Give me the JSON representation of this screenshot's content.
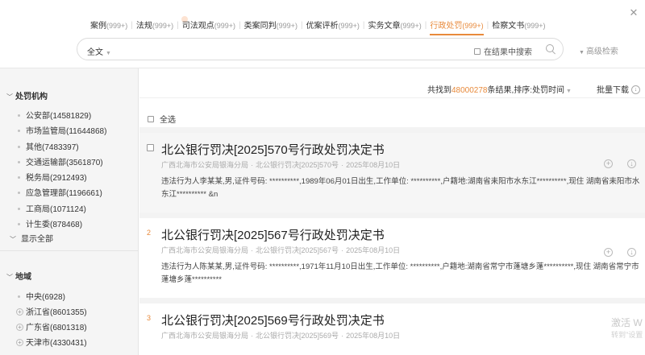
{
  "tabs": [
    {
      "label": "案例",
      "count": "(999+)"
    },
    {
      "label": "法规",
      "count": "(999+)"
    },
    {
      "label": "司法观点",
      "count": "(999+)"
    },
    {
      "label": "类案同判",
      "count": "(999+)"
    },
    {
      "label": "优案评析",
      "count": "(999+)"
    },
    {
      "label": "实务文章",
      "count": "(999+)"
    },
    {
      "label": "行政处罚",
      "count": "(999+)"
    },
    {
      "label": "检察文书",
      "count": "(999+)"
    }
  ],
  "search": {
    "scope": "全文",
    "value": "",
    "within_label": "在结果中搜索",
    "advanced_label": "高级检索"
  },
  "sidebar": {
    "penalty_org_title": "处罚机构",
    "penalty_orgs": [
      "公安部(14581829)",
      "市场监管局(11644868)",
      "其他(7483397)",
      "交通运输部(3561870)",
      "税务局(2912493)",
      "应急管理部(1196661)",
      "工商局(1071124)",
      "计生委(878468)"
    ],
    "show_all": "显示全部",
    "region_title": "地域",
    "regions": [
      {
        "label": "中央(6928)",
        "expandable": false
      },
      {
        "label": "浙江省(8601355)",
        "expandable": true
      },
      {
        "label": "广东省(6801318)",
        "expandable": true
      },
      {
        "label": "天津市(4330431)",
        "expandable": true
      }
    ]
  },
  "results": {
    "prefix": "共找到",
    "count": "48000278",
    "suffix": "条结果,排序:",
    "sort": "处罚时间",
    "batch_download": "批量下载",
    "select_all": "全选"
  },
  "items": [
    {
      "index": "",
      "title": "北公银行罚决[2025]570号行政处罚决定书",
      "authority": "广西北海市公安局银海分局",
      "docno": "北公银行罚决[2025]570号",
      "date": "2025年08月10日",
      "snippet": "违法行为人李某某,男,证件号码: **********,1989年06月01日出生,工作单位: **********,户籍地:湖南省耒阳市水东江**********,现住 湖南省耒阳市水东江********** &n"
    },
    {
      "index": "2",
      "title": "北公银行罚决[2025]567号行政处罚决定书",
      "authority": "广西北海市公安局银海分局",
      "docno": "北公银行罚决[2025]567号",
      "date": "2025年08月10日",
      "snippet": "违法行为人陈某某,男,证件号码: **********,1971年11月10日出生,工作单位: **********,户籍地:湖南省常宁市蓬塘乡蓬**********,现住 湖南省常宁市蓬塘乡蓬**********"
    },
    {
      "index": "3",
      "title": "北公银行罚决[2025]569号行政处罚决定书",
      "authority": "广西北海市公安局银海分局",
      "docno": "北公银行罚决[2025]569号",
      "date": "2025年08月10日",
      "snippet": ""
    }
  ],
  "watermark": {
    "line1": "激活 W",
    "line2": "转到\"设置"
  }
}
